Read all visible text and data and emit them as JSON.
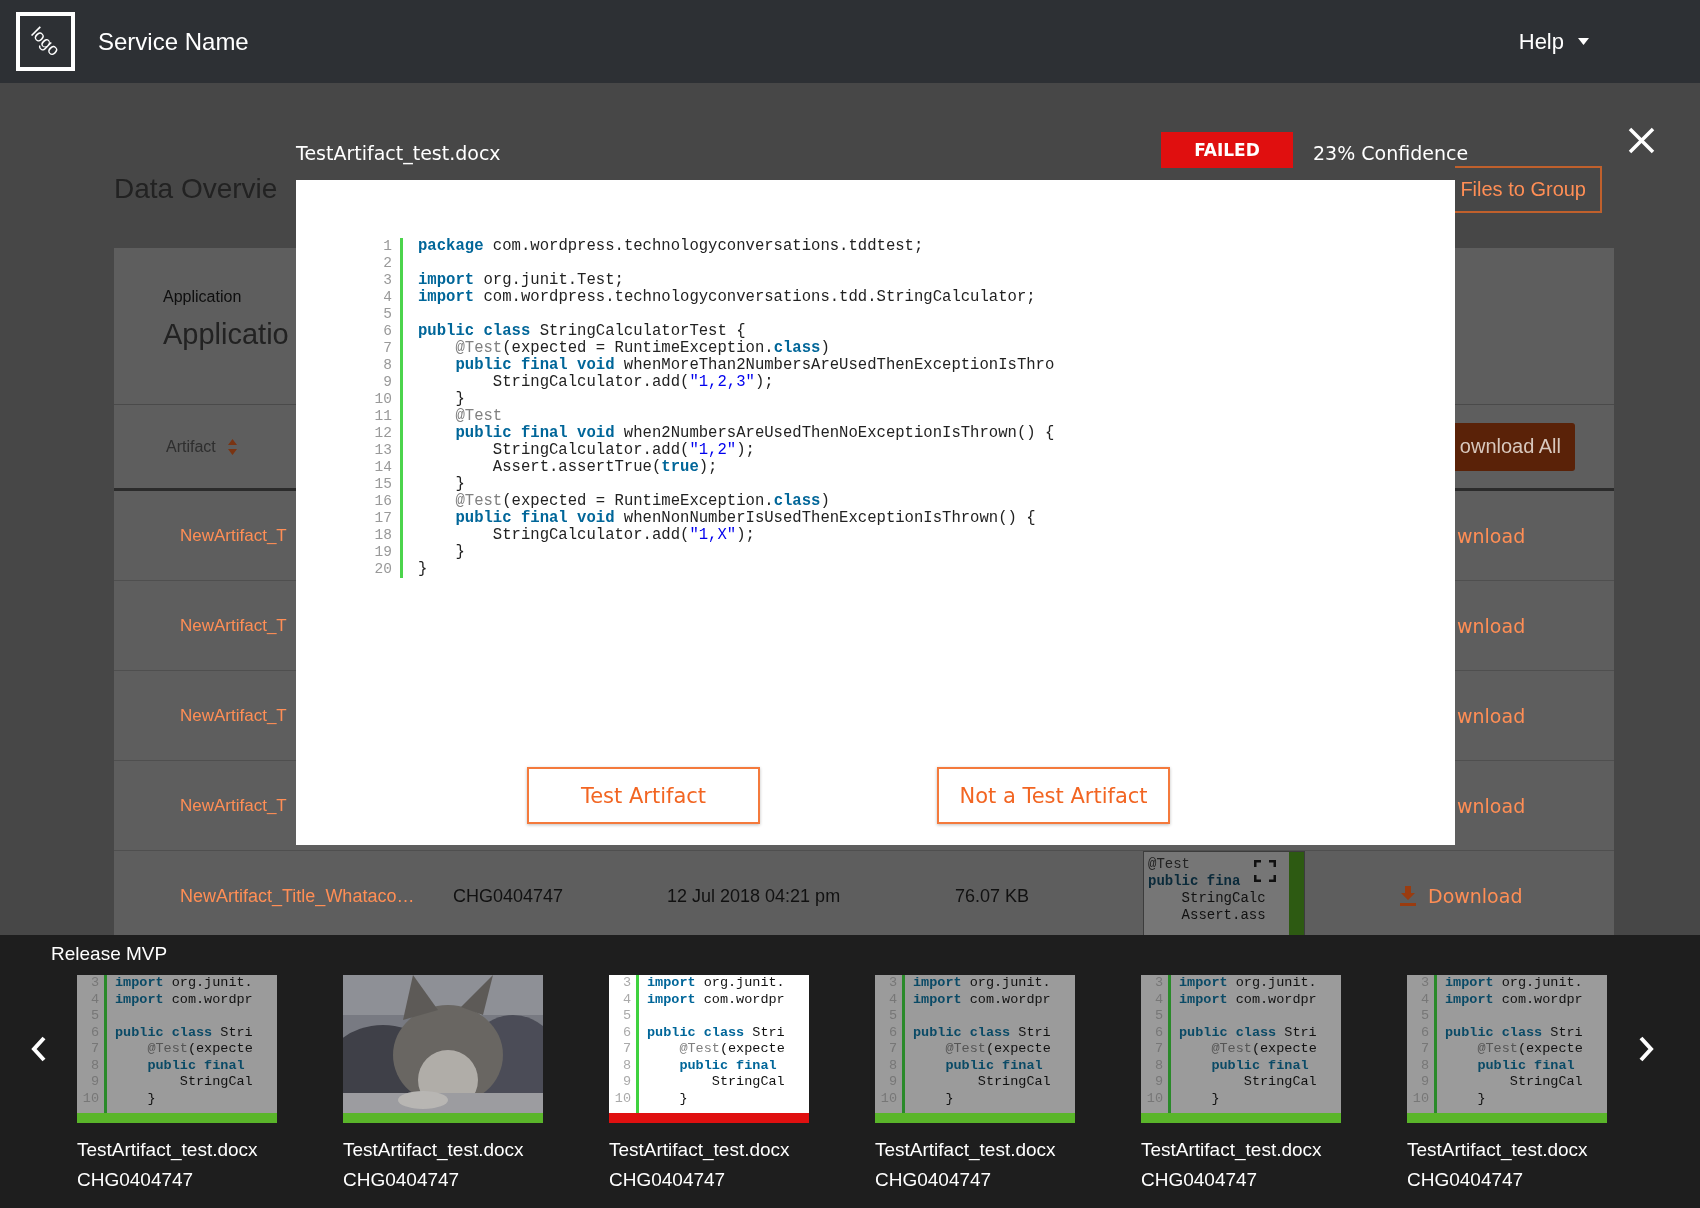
{
  "header": {
    "logo": "logo",
    "service_name": "Service Name",
    "help_menu": "Help"
  },
  "page": {
    "title": "Data Overvie",
    "files_button": "Files to Group",
    "application_label": "Application",
    "application_value": "Applicatio",
    "artifact_column": "Artifact",
    "download_all_button": "ownload All",
    "rows": [
      {
        "title": "NewArtifact_T",
        "action": "wnload"
      },
      {
        "title": "NewArtifact_T",
        "action": "wnload"
      },
      {
        "title": "NewArtifact_T",
        "action": "wnload"
      },
      {
        "title": "NewArtifact_T",
        "action": "wnload"
      }
    ],
    "full_row": {
      "title": "NewArtifact_Title_Whataco…",
      "change": "CHG0404747",
      "date": "12 Jul 2018 04:21 pm",
      "size": "76.07 KB",
      "action": "Download",
      "preview_lines": [
        {
          "tokens": [
            {
              "kind": "annotation",
              "text": "@Test"
            }
          ]
        },
        {
          "tokens": [
            {
              "kind": "keyword",
              "text": "public fina"
            }
          ]
        },
        {
          "tokens": [
            {
              "kind": "plain",
              "text": "    StringCalc"
            }
          ]
        },
        {
          "tokens": [
            {
              "kind": "plain",
              "text": "    Assert.ass"
            }
          ]
        }
      ]
    }
  },
  "viewer": {
    "filename": "TestArtifact_test.docx",
    "status": "FAILED",
    "confidence": "23% Confidence",
    "code_lines": [
      {
        "number": "1",
        "tokens": [
          {
            "kind": "keyword",
            "text": "package"
          },
          {
            "kind": "plain",
            "text": " com.wordpress.technologyconversations.tddtest;"
          }
        ]
      },
      {
        "number": "2"
      },
      {
        "number": "3",
        "tokens": [
          {
            "kind": "keyword",
            "text": "import"
          },
          {
            "kind": "plain",
            "text": " org.junit.Test;"
          }
        ]
      },
      {
        "number": "4",
        "tokens": [
          {
            "kind": "keyword",
            "text": "import"
          },
          {
            "kind": "plain",
            "text": " com.wordpress.technologyconversations.tdd.StringCalculator;"
          }
        ]
      },
      {
        "number": "5"
      },
      {
        "number": "6",
        "tokens": [
          {
            "kind": "keyword",
            "text": "public class"
          },
          {
            "kind": "plain",
            "text": " StringCalculatorTest {"
          }
        ]
      },
      {
        "number": "7",
        "tokens": [
          {
            "kind": "annotation",
            "text": "    @Test"
          },
          {
            "kind": "plain",
            "text": "(expected = RuntimeException."
          },
          {
            "kind": "keyword",
            "text": "class"
          },
          {
            "kind": "plain",
            "text": ")"
          }
        ]
      },
      {
        "number": "8",
        "tokens": [
          {
            "kind": "keyword",
            "text": "    public final void"
          },
          {
            "kind": "plain",
            "text": " whenMoreThan2NumbersAreUsedThenExceptionIsThro"
          }
        ]
      },
      {
        "number": "9",
        "tokens": [
          {
            "kind": "plain",
            "text": "        StringCalculator.add("
          },
          {
            "kind": "string",
            "text": "\"1,2,3\""
          },
          {
            "kind": "plain",
            "text": ");"
          }
        ]
      },
      {
        "number": "10",
        "tokens": [
          {
            "kind": "plain",
            "text": "    }"
          }
        ]
      },
      {
        "number": "11",
        "tokens": [
          {
            "kind": "annotation",
            "text": "    @Test"
          }
        ]
      },
      {
        "number": "12",
        "tokens": [
          {
            "kind": "keyword",
            "text": "    public final void"
          },
          {
            "kind": "plain",
            "text": " when2NumbersAreUsedThenNoExceptionIsThrown() {"
          }
        ]
      },
      {
        "number": "13",
        "tokens": [
          {
            "kind": "plain",
            "text": "        StringCalculator.add("
          },
          {
            "kind": "string",
            "text": "\"1,2\""
          },
          {
            "kind": "plain",
            "text": ");"
          }
        ]
      },
      {
        "number": "14",
        "tokens": [
          {
            "kind": "plain",
            "text": "        Assert.assertTrue("
          },
          {
            "kind": "keyword",
            "text": "true"
          },
          {
            "kind": "plain",
            "text": ");"
          }
        ]
      },
      {
        "number": "15",
        "tokens": [
          {
            "kind": "plain",
            "text": "    }"
          }
        ]
      },
      {
        "number": "16",
        "tokens": [
          {
            "kind": "annotation",
            "text": "    @Test"
          },
          {
            "kind": "plain",
            "text": "(expected = RuntimeException."
          },
          {
            "kind": "keyword",
            "text": "class"
          },
          {
            "kind": "plain",
            "text": ")"
          }
        ]
      },
      {
        "number": "17",
        "tokens": [
          {
            "kind": "keyword",
            "text": "    public final void"
          },
          {
            "kind": "plain",
            "text": " whenNonNumberIsUsedThenExceptionIsThrown() {"
          }
        ]
      },
      {
        "number": "18",
        "tokens": [
          {
            "kind": "plain",
            "text": "        StringCalculator.add("
          },
          {
            "kind": "string",
            "text": "\"1,X\""
          },
          {
            "kind": "plain",
            "text": ");"
          }
        ]
      },
      {
        "number": "19",
        "tokens": [
          {
            "kind": "plain",
            "text": "    }"
          }
        ]
      },
      {
        "number": "20",
        "tokens": [
          {
            "kind": "plain",
            "text": "}"
          }
        ]
      }
    ],
    "buttons": [
      "Test Artifact",
      "Not a Test Artifact"
    ]
  },
  "strip": {
    "title": "Release MVP",
    "thumbnails": [
      {
        "kind": "code",
        "selected": false,
        "color": "#5ab52a",
        "filename": "TestArtifact_test.docx",
        "change": "CHG0404747",
        "lines": [
          {
            "number": "3",
            "tokens": [
              {
                "kind": "keyword",
                "text": "import"
              },
              {
                "kind": "plain",
                "text": " org.junit."
              }
            ]
          },
          {
            "number": "4",
            "tokens": [
              {
                "kind": "keyword",
                "text": "import"
              },
              {
                "kind": "plain",
                "text": " com.wordpr"
              }
            ]
          },
          {
            "number": "5"
          },
          {
            "number": "6",
            "tokens": [
              {
                "kind": "keyword",
                "text": "public class"
              },
              {
                "kind": "plain",
                "text": " Stri"
              }
            ]
          },
          {
            "number": "7",
            "tokens": [
              {
                "kind": "annotation",
                "text": "    @Test"
              },
              {
                "kind": "plain",
                "text": "(expecte"
              }
            ]
          },
          {
            "number": "8",
            "tokens": [
              {
                "kind": "keyword",
                "text": "    public final"
              }
            ]
          },
          {
            "number": "9",
            "tokens": [
              {
                "kind": "plain",
                "text": "        StringCal"
              }
            ]
          },
          {
            "number": "10",
            "tokens": [
              {
                "kind": "plain",
                "text": "    }"
              }
            ]
          }
        ]
      },
      {
        "kind": "picture",
        "selected": false,
        "color": "#5ab52a",
        "filename": "TestArtifact_test.docx",
        "change": "CHG0404747"
      },
      {
        "kind": "code",
        "selected": true,
        "color": "#e01010",
        "filename": "TestArtifact_test.docx",
        "change": "CHG0404747",
        "lines": [
          {
            "number": "3",
            "tokens": [
              {
                "kind": "keyword",
                "text": "import"
              },
              {
                "kind": "plain",
                "text": " org.junit."
              }
            ]
          },
          {
            "number": "4",
            "tokens": [
              {
                "kind": "keyword",
                "text": "import"
              },
              {
                "kind": "plain",
                "text": " com.wordpr"
              }
            ]
          },
          {
            "number": "5"
          },
          {
            "number": "6",
            "tokens": [
              {
                "kind": "keyword",
                "text": "public class"
              },
              {
                "kind": "plain",
                "text": " Stri"
              }
            ]
          },
          {
            "number": "7",
            "tokens": [
              {
                "kind": "annotation",
                "text": "    @Test"
              },
              {
                "kind": "plain",
                "text": "(expecte"
              }
            ]
          },
          {
            "number": "8",
            "tokens": [
              {
                "kind": "keyword",
                "text": "    public final"
              }
            ]
          },
          {
            "number": "9",
            "tokens": [
              {
                "kind": "plain",
                "text": "        StringCal"
              }
            ]
          },
          {
            "number": "10",
            "tokens": [
              {
                "kind": "plain",
                "text": "    }"
              }
            ]
          }
        ]
      },
      {
        "kind": "code",
        "selected": false,
        "color": "#5ab52a",
        "filename": "TestArtifact_test.docx",
        "change": "CHG0404747",
        "lines": [
          {
            "number": "3",
            "tokens": [
              {
                "kind": "keyword",
                "text": "import"
              },
              {
                "kind": "plain",
                "text": " org.junit."
              }
            ]
          },
          {
            "number": "4",
            "tokens": [
              {
                "kind": "keyword",
                "text": "import"
              },
              {
                "kind": "plain",
                "text": " com.wordpr"
              }
            ]
          },
          {
            "number": "5"
          },
          {
            "number": "6",
            "tokens": [
              {
                "kind": "keyword",
                "text": "public class"
              },
              {
                "kind": "plain",
                "text": " Stri"
              }
            ]
          },
          {
            "number": "7",
            "tokens": [
              {
                "kind": "annotation",
                "text": "    @Test"
              },
              {
                "kind": "plain",
                "text": "(expecte"
              }
            ]
          },
          {
            "number": "8",
            "tokens": [
              {
                "kind": "keyword",
                "text": "    public final"
              }
            ]
          },
          {
            "number": "9",
            "tokens": [
              {
                "kind": "plain",
                "text": "        StringCal"
              }
            ]
          },
          {
            "number": "10",
            "tokens": [
              {
                "kind": "plain",
                "text": "    }"
              }
            ]
          }
        ]
      },
      {
        "kind": "code",
        "selected": false,
        "color": "#5ab52a",
        "filename": "TestArtifact_test.docx",
        "change": "CHG0404747",
        "lines": [
          {
            "number": "3",
            "tokens": [
              {
                "kind": "keyword",
                "text": "import"
              },
              {
                "kind": "plain",
                "text": " org.junit."
              }
            ]
          },
          {
            "number": "4",
            "tokens": [
              {
                "kind": "keyword",
                "text": "import"
              },
              {
                "kind": "plain",
                "text": " com.wordpr"
              }
            ]
          },
          {
            "number": "5"
          },
          {
            "number": "6",
            "tokens": [
              {
                "kind": "keyword",
                "text": "public class"
              },
              {
                "kind": "plain",
                "text": " Stri"
              }
            ]
          },
          {
            "number": "7",
            "tokens": [
              {
                "kind": "annotation",
                "text": "    @Test"
              },
              {
                "kind": "plain",
                "text": "(expecte"
              }
            ]
          },
          {
            "number": "8",
            "tokens": [
              {
                "kind": "keyword",
                "text": "    public final"
              }
            ]
          },
          {
            "number": "9",
            "tokens": [
              {
                "kind": "plain",
                "text": "        StringCal"
              }
            ]
          },
          {
            "number": "10",
            "tokens": [
              {
                "kind": "plain",
                "text": "    }"
              }
            ]
          }
        ]
      },
      {
        "kind": "code",
        "selected": false,
        "color": "#5ab52a",
        "filename": "TestArtifact_test.docx",
        "change": "CHG0404747",
        "lines": [
          {
            "number": "3",
            "tokens": [
              {
                "kind": "keyword",
                "text": "import"
              },
              {
                "kind": "plain",
                "text": " org.junit."
              }
            ]
          },
          {
            "number": "4",
            "tokens": [
              {
                "kind": "keyword",
                "text": "import"
              },
              {
                "kind": "plain",
                "text": " com.wordpr"
              }
            ]
          },
          {
            "number": "5"
          },
          {
            "number": "6",
            "tokens": [
              {
                "kind": "keyword",
                "text": "public class"
              },
              {
                "kind": "plain",
                "text": " Stri"
              }
            ]
          },
          {
            "number": "7",
            "tokens": [
              {
                "kind": "annotation",
                "text": "    @Test"
              },
              {
                "kind": "plain",
                "text": "(expecte"
              }
            ]
          },
          {
            "number": "8",
            "tokens": [
              {
                "kind": "keyword",
                "text": "    public final"
              }
            ]
          },
          {
            "number": "9",
            "tokens": [
              {
                "kind": "plain",
                "text": "        StringCal"
              }
            ]
          },
          {
            "number": "10",
            "tokens": [
              {
                "kind": "plain",
                "text": "    }"
              }
            ]
          }
        ]
      }
    ]
  }
}
